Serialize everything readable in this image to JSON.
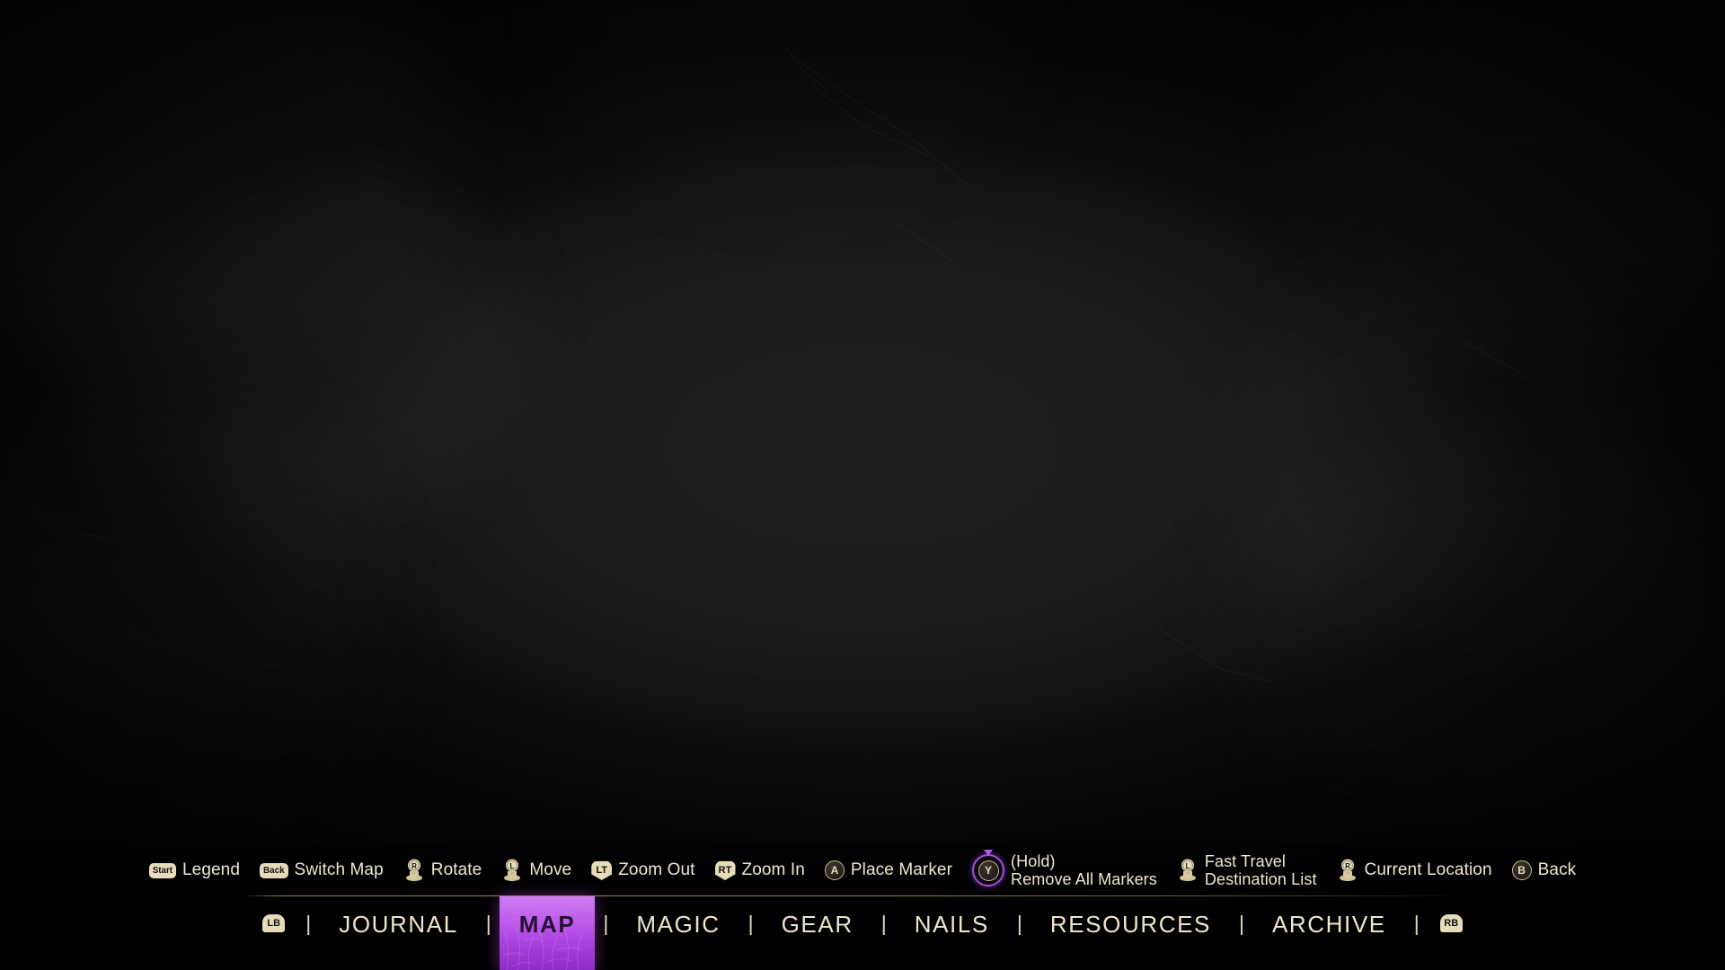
{
  "screen": {
    "name": "map-screen",
    "background_color": "#0a0a0a"
  },
  "prompts": [
    {
      "glyph": "start-button",
      "glyph_label": "Start",
      "glyph_type": "pill",
      "label": "Legend"
    },
    {
      "glyph": "back-button",
      "glyph_label": "Back",
      "glyph_type": "pill",
      "label": "Switch Map"
    },
    {
      "glyph": "right-stick",
      "glyph_label": "R",
      "glyph_type": "stick",
      "label": "Rotate"
    },
    {
      "glyph": "left-stick",
      "glyph_label": "L",
      "glyph_type": "stick",
      "label": "Move"
    },
    {
      "glyph": "left-trigger",
      "glyph_label": "LT",
      "glyph_type": "trigger",
      "label": "Zoom Out"
    },
    {
      "glyph": "right-trigger",
      "glyph_label": "RT",
      "glyph_type": "trigger",
      "label": "Zoom In"
    },
    {
      "glyph": "a-button",
      "glyph_label": "A",
      "glyph_type": "face",
      "label": "Place Marker"
    },
    {
      "glyph": "y-button-hold",
      "glyph_label": "Y",
      "glyph_type": "hold",
      "label_line1": "(Hold)",
      "label_line2": "Remove All Markers"
    },
    {
      "glyph": "left-stick-click",
      "glyph_label": "L",
      "glyph_type": "stick",
      "label_line1": "Fast Travel",
      "label_line2": "Destination List"
    },
    {
      "glyph": "right-stick-click",
      "glyph_label": "R",
      "glyph_type": "stick",
      "label": "Current Location"
    },
    {
      "glyph": "b-button",
      "glyph_label": "B",
      "glyph_type": "face",
      "label": "Back"
    }
  ],
  "tabs": {
    "left_bumper": "LB",
    "right_bumper": "RB",
    "separator": "|",
    "items": [
      {
        "label": "JOURNAL",
        "active": false
      },
      {
        "label": "MAP",
        "active": true
      },
      {
        "label": "MAGIC",
        "active": false
      },
      {
        "label": "GEAR",
        "active": false
      },
      {
        "label": "NAILS",
        "active": false
      },
      {
        "label": "RESOURCES",
        "active": false
      },
      {
        "label": "ARCHIVE",
        "active": false
      }
    ],
    "active_tab": "MAP"
  },
  "colors": {
    "text_gold": "#efe6ca",
    "glyph_fill": "#e6dcba",
    "glyph_text": "#17150f",
    "accent_purple": "#b158ec",
    "hold_ring": "#9b4fd6",
    "divider_gold": "#ba9a60",
    "backdrop": "#1c1c1c"
  }
}
